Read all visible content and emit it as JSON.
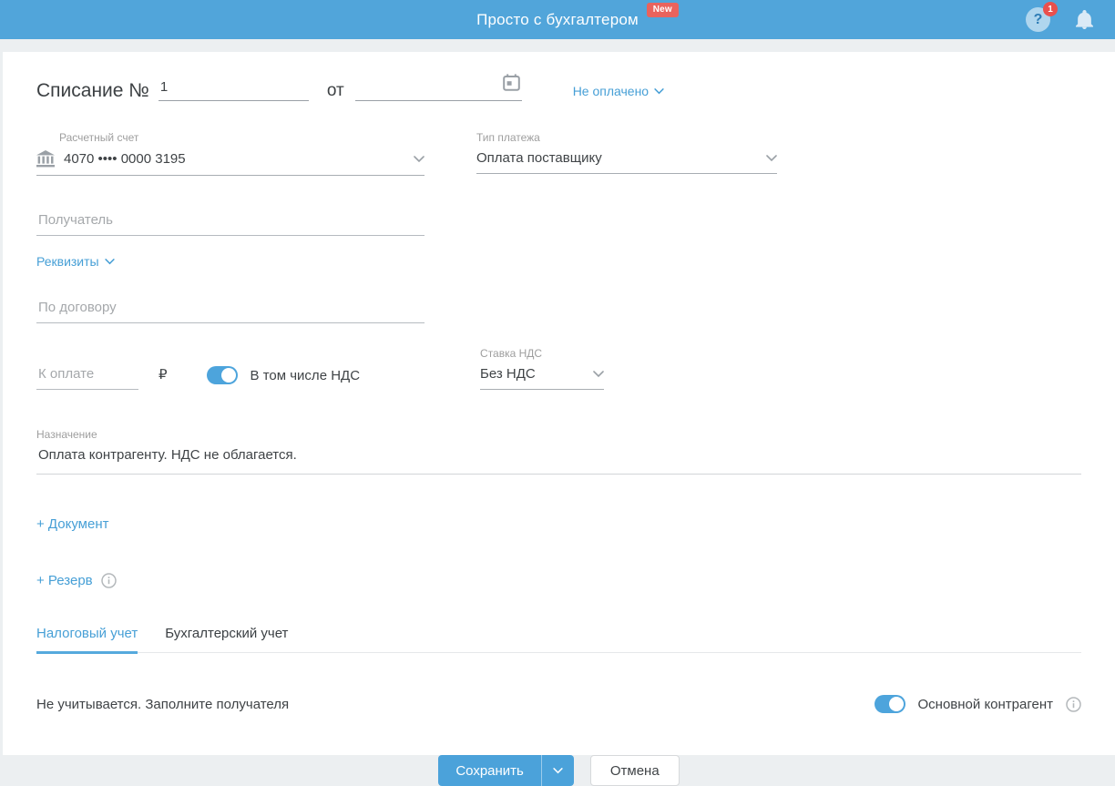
{
  "header": {
    "title": "Просто с бухгалтером",
    "new_badge": "New",
    "help_badge": "1"
  },
  "document": {
    "title": "Списание №",
    "number": "1",
    "date_preposition": "от",
    "date_value": "",
    "status": "Не оплачено"
  },
  "account": {
    "label": "Расчетный счет",
    "value": "4070 •••• 0000 3195"
  },
  "payment_type": {
    "label": "Тип платежа",
    "value": "Оплата поставщику"
  },
  "recipient": {
    "placeholder": "Получатель"
  },
  "requisites": {
    "label": "Реквизиты"
  },
  "contract": {
    "placeholder": "По договору"
  },
  "amount": {
    "placeholder": "К оплате",
    "currency": "₽"
  },
  "vat_toggle": {
    "label": "В том числе НДС",
    "state": "on"
  },
  "vat_rate": {
    "label": "Ставка НДС",
    "value": "Без НДС"
  },
  "purpose": {
    "label": "Назначение",
    "value": "Оплата контрагенту. НДС не облагается."
  },
  "add_document": {
    "label": "+ Документ"
  },
  "add_reserve": {
    "label": "+ Резерв"
  },
  "tabs": [
    {
      "label": "Налоговый учет",
      "active": true
    },
    {
      "label": "Бухгалтерский учет",
      "active": false
    }
  ],
  "tax_info": {
    "message": "Не учитывается. Заполните получателя"
  },
  "main_contractor": {
    "label": "Основной контрагент",
    "state": "on"
  },
  "actions": {
    "save": "Сохранить",
    "cancel": "Отмена"
  },
  "colors": {
    "header_blue": "#51a5da",
    "accent_blue": "#469fd6",
    "badge_red": "#e9635d"
  }
}
